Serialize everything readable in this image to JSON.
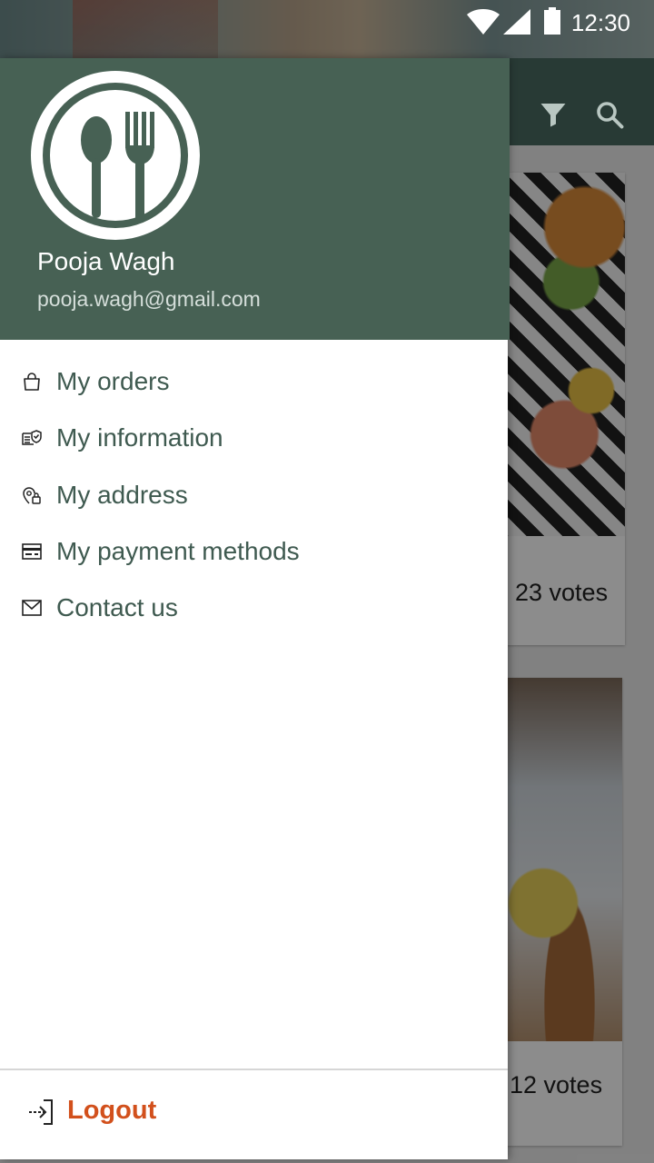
{
  "status_bar": {
    "time": "12:30",
    "icons": [
      "wifi-icon",
      "signal-icon",
      "battery-icon"
    ]
  },
  "background_app": {
    "toolbar_icons": [
      "filter-icon",
      "search-icon"
    ],
    "cards": [
      {
        "votes": "23 votes"
      },
      {
        "votes": "12 votes"
      }
    ]
  },
  "drawer": {
    "header": {
      "logo": "fork-spoon-logo",
      "name": "Pooja Wagh",
      "email": "pooja.wagh@gmail.com"
    },
    "menu": [
      {
        "label": "My orders",
        "icon": "shopping-bag-icon"
      },
      {
        "label": "My information",
        "icon": "id-card-icon"
      },
      {
        "label": "My address",
        "icon": "location-icon"
      },
      {
        "label": "My payment methods",
        "icon": "credit-card-icon"
      },
      {
        "label": "Contact us",
        "icon": "mail-icon"
      }
    ],
    "logout": {
      "label": "Logout",
      "icon": "logout-icon"
    }
  },
  "colors": {
    "header_bg": "#476154",
    "menu_text": "#3f5a50",
    "logout_text": "#d2501c"
  }
}
